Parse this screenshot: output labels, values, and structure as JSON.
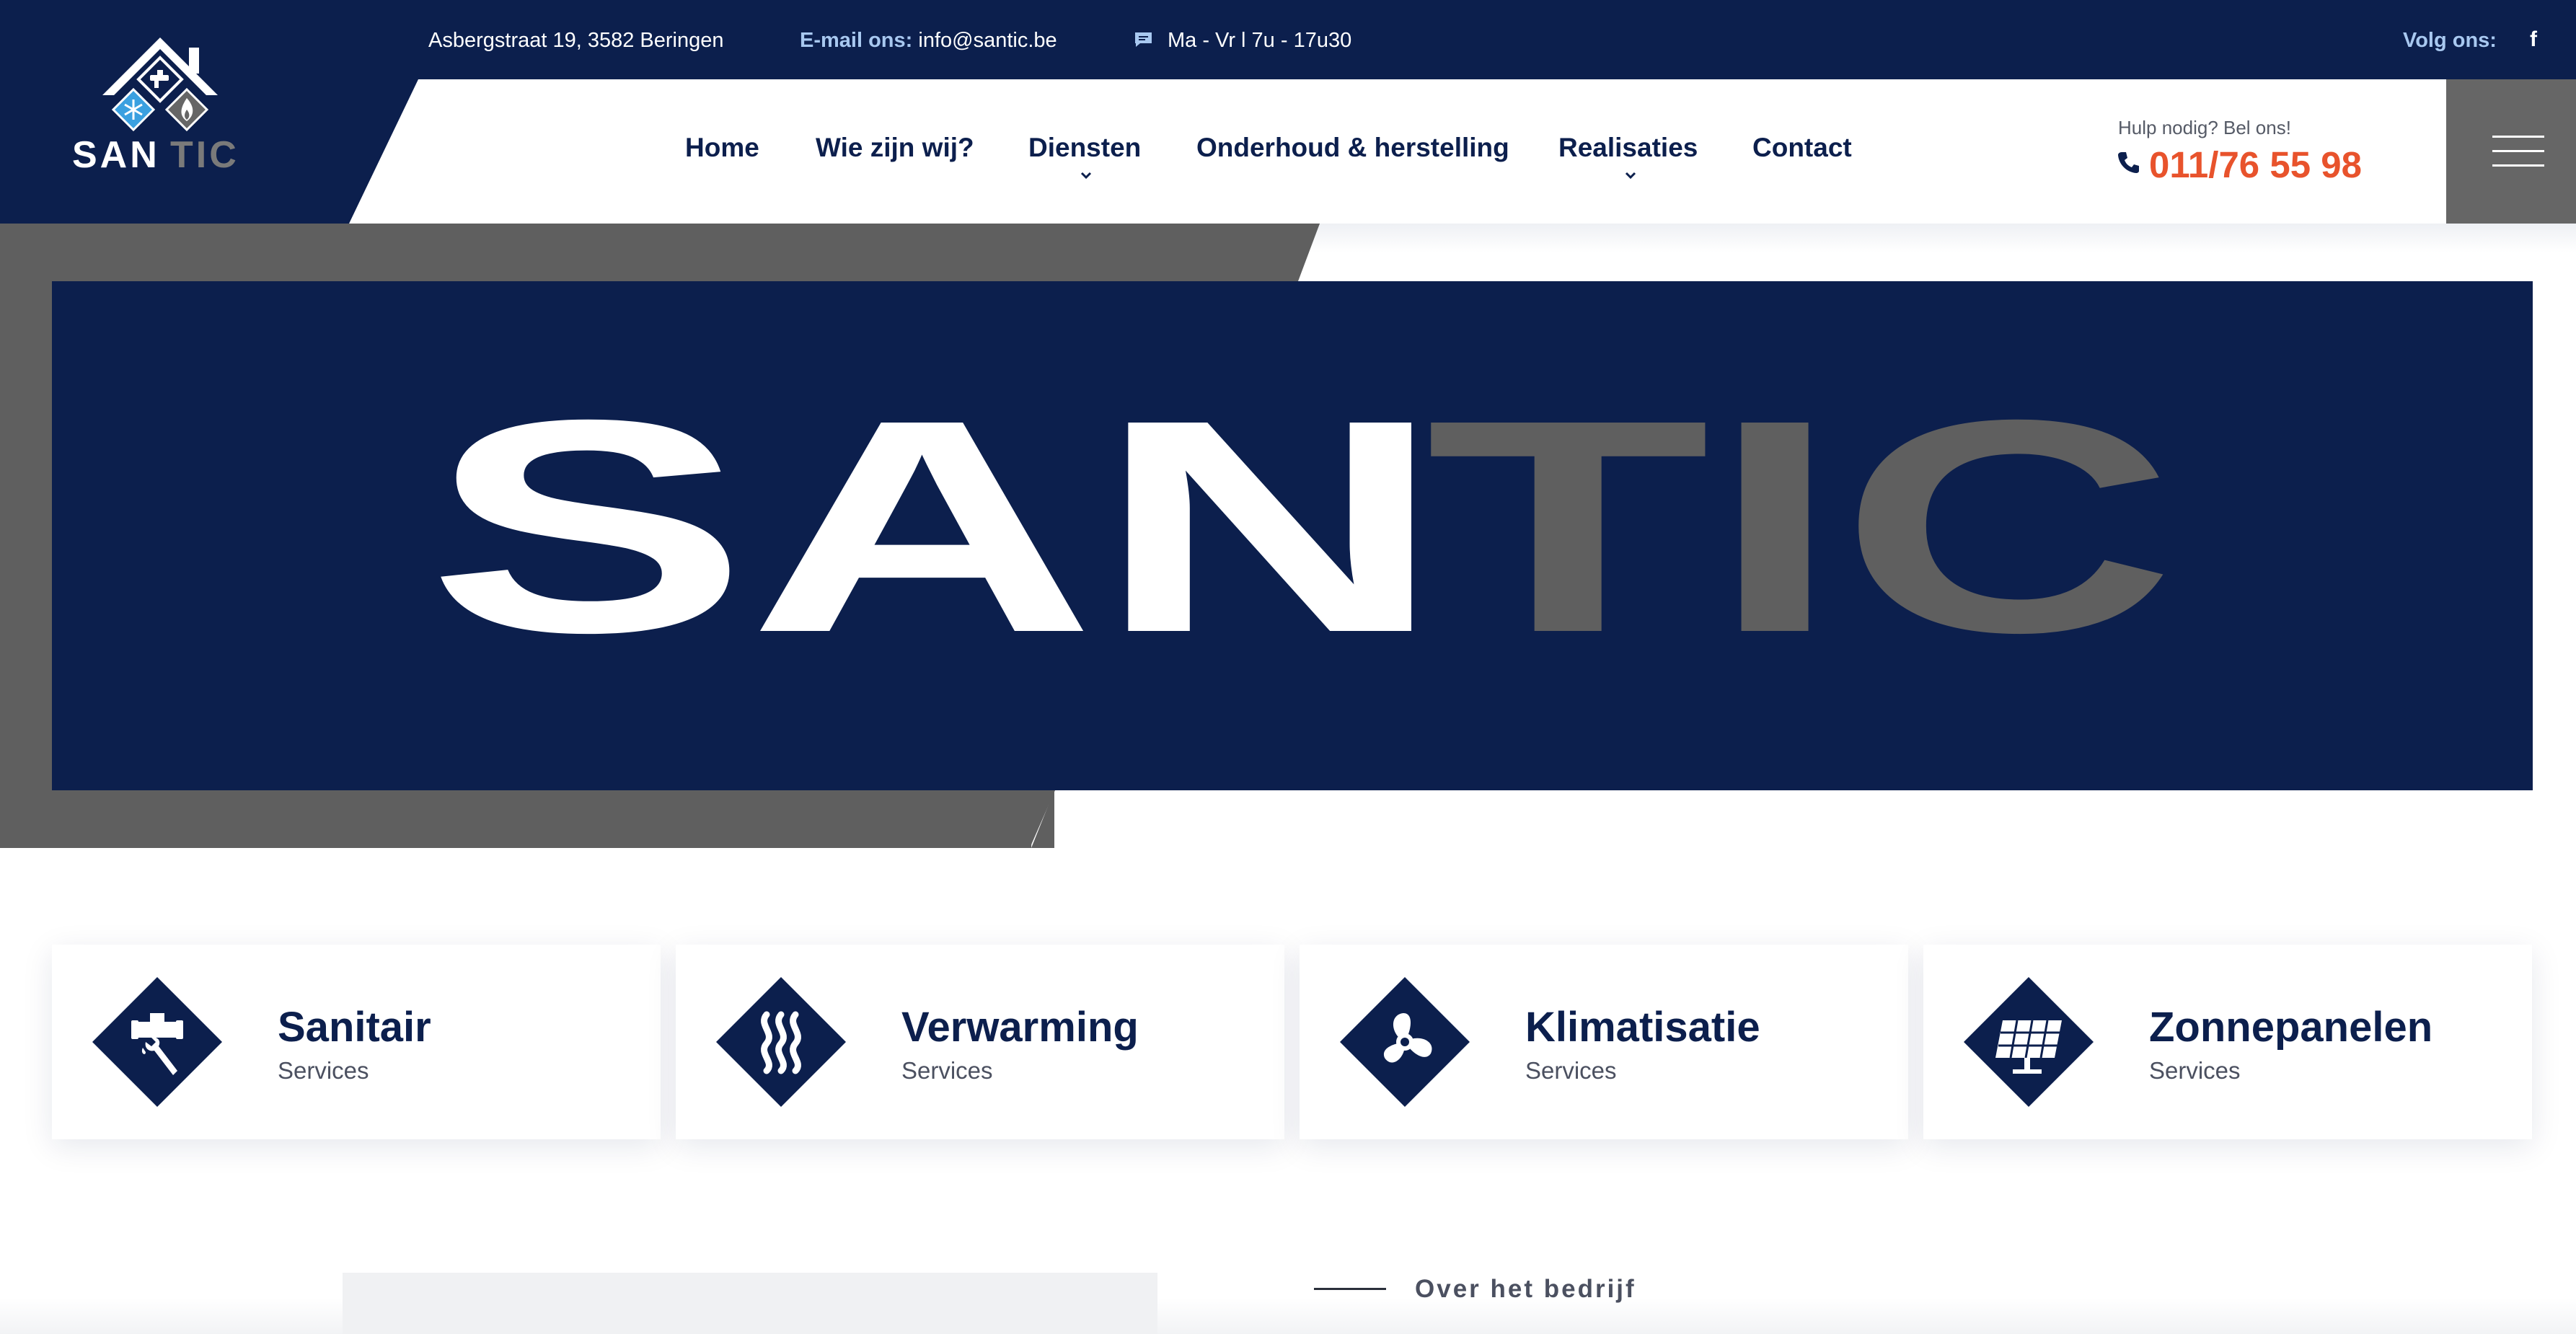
{
  "topbar": {
    "address": "Asbergstraat 19, 3582 Beringen",
    "email_label": "E-mail ons:",
    "email_value": "info@santic.be",
    "hours": "Ma - Vr l 7u - 17u30",
    "follow_label": "Volg ons:",
    "social_icon": "facebook-icon"
  },
  "logo": {
    "text_primary": "SAN",
    "text_secondary": "TIC"
  },
  "nav": {
    "items": [
      {
        "label": "Home",
        "has_dropdown": false
      },
      {
        "label": "Wie zijn wij?",
        "has_dropdown": false
      },
      {
        "label": "Diensten",
        "has_dropdown": true
      },
      {
        "label": "Onderhoud & herstelling",
        "has_dropdown": false
      },
      {
        "label": "Realisaties",
        "has_dropdown": true
      },
      {
        "label": "Contact",
        "has_dropdown": false
      }
    ],
    "help_text": "Hulp nodig? Bel ons!",
    "phone": "011/76 55 98",
    "menu_icon": "hamburger-icon"
  },
  "hero": {
    "brand_primary": "SAN",
    "brand_secondary": "TIC"
  },
  "services": [
    {
      "title": "Sanitair",
      "subtitle": "Services",
      "icon": "faucet-wrench-icon"
    },
    {
      "title": "Verwarming",
      "subtitle": "Services",
      "icon": "heat-waves-icon"
    },
    {
      "title": "Klimatisatie",
      "subtitle": "Services",
      "icon": "fan-icon"
    },
    {
      "title": "Zonnepanelen",
      "subtitle": "Services",
      "icon": "solar-panel-icon"
    }
  ],
  "about": {
    "kicker": "Over het bedrijf"
  },
  "colors": {
    "navy": "#0c1f4d",
    "grey": "#5f5f5f",
    "accent_orange": "#e8532c",
    "light_blue": "#a8c8f0",
    "logo_blue": "#3aa0e0"
  }
}
